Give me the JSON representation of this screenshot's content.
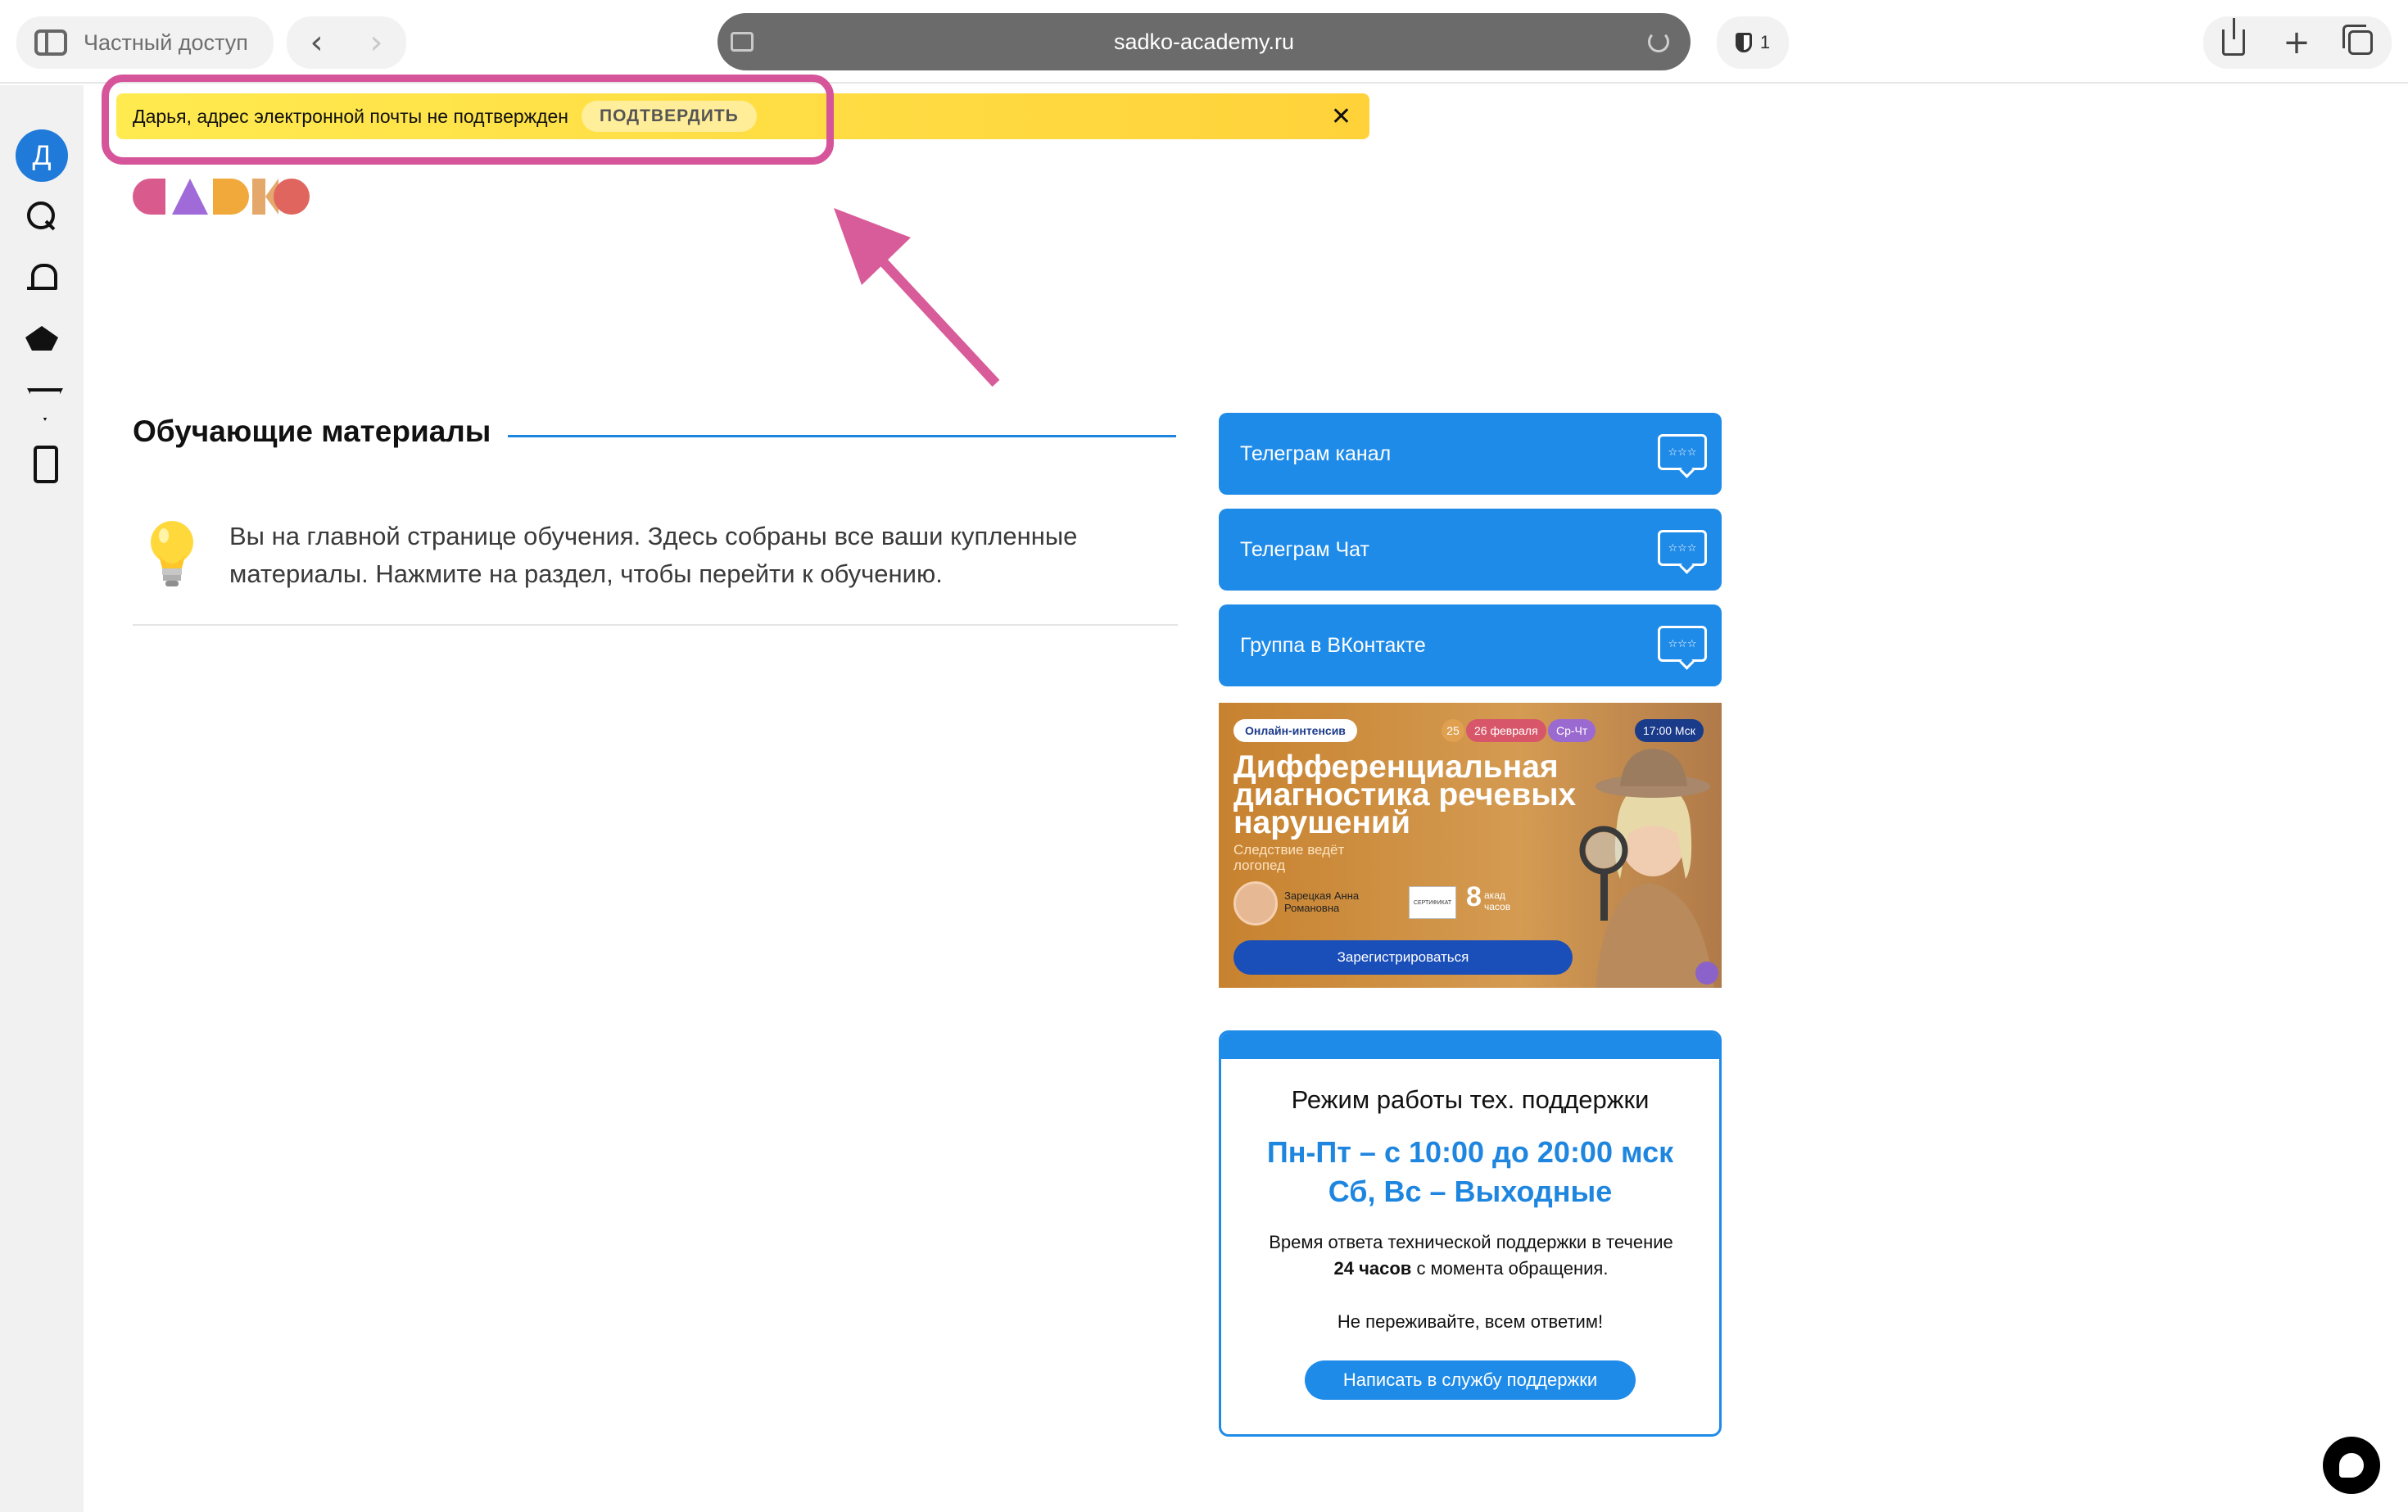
{
  "browser": {
    "private_label": "Частный доступ",
    "url": "sadko-academy.ru",
    "tracker_count": "1",
    "back_glyph": "‹",
    "forward_glyph": "›",
    "new_tab_glyph": "+"
  },
  "sidebar": {
    "avatar_letter": "Д",
    "icons": [
      "search-icon",
      "bell-icon",
      "graduation-cap-icon",
      "filter-icon",
      "phone-icon"
    ]
  },
  "banner": {
    "message": "Дарья, адрес электронной почты не подтвержден",
    "confirm_label": "ПОДТВЕРДИТЬ",
    "close_glyph": "✕",
    "background": "#ffdc45",
    "highlight_color": "#d6559a"
  },
  "logo": {
    "text": "SADKO",
    "colors": [
      "#d95b8e",
      "#a06ad8",
      "#f2a93b",
      "#e4a86b",
      "#e0655e"
    ]
  },
  "main": {
    "section_title": "Обучающие материалы",
    "hint_text": "Вы на главной странице обучения. Здесь собраны все ваши купленные материалы. Нажмите на раздел, чтобы перейти к обучению."
  },
  "links": [
    {
      "label": "Телеграм канал"
    },
    {
      "label": "Телеграм Чат"
    },
    {
      "label": "Группа в ВКонтакте"
    }
  ],
  "promo": {
    "badge": "Онлайн-интенсив",
    "date_start": "25",
    "date_range": "26 февраля",
    "days": "Ср-Чт",
    "time": "17:00 Мск",
    "headline": "Дифференциальная диагностика речевых нарушений",
    "subheadline": "Следствие ведёт логопед",
    "author": "Зарецкая Анна Романовна",
    "certificate": "СЕРТИФИКАТ",
    "hours_num": "8",
    "hours_label": "акад часов",
    "register_label": "Зарегистрироваться"
  },
  "support": {
    "title": "Режим работы тех. поддержки",
    "hours_line1": "Пн-Пт – с 10:00 до 20:00 мск",
    "hours_line2": "Сб, Вс – Выходные",
    "note_prefix": "Время ответа технической поддержки в течение",
    "note_bold": "24 часов",
    "note_suffix": "с момента обращения.",
    "calm": "Не переживайте, всем ответим!",
    "button_label": "Написать в службу поддержки"
  },
  "colors": {
    "accent_blue": "#1f8be8",
    "heading_blue": "#1f86e0"
  }
}
